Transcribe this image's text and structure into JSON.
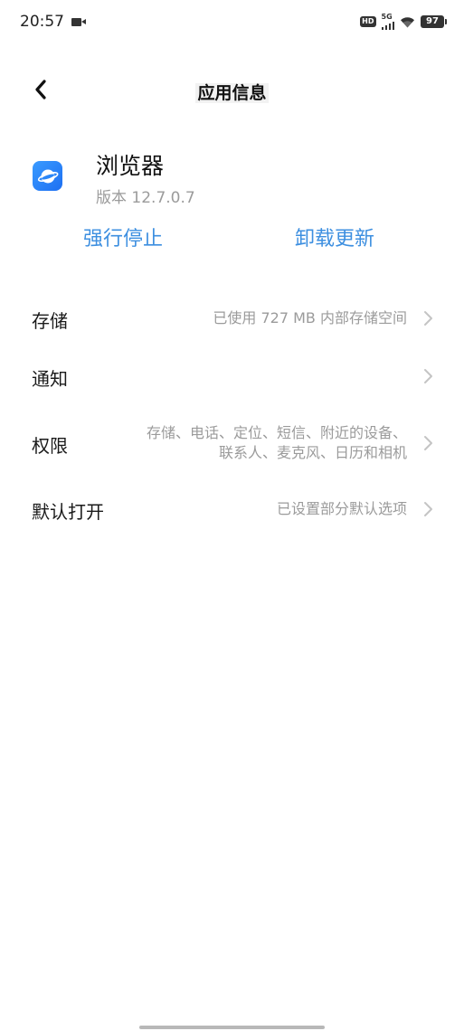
{
  "status_bar": {
    "time": "20:57",
    "hd": "HD",
    "network": "5G",
    "battery": "97"
  },
  "header": {
    "title": "应用信息",
    "back_icon": "chevron-left-icon"
  },
  "app": {
    "name": "浏览器",
    "version": "版本 12.7.0.7",
    "icon": "planet-icon",
    "icon_color": "#2b86f7"
  },
  "actions": {
    "force_stop": "强行停止",
    "uninstall_updates": "卸载更新",
    "color": "#3d8fe0"
  },
  "settings": [
    {
      "label": "存储",
      "value_lines": [
        "已使用 727 MB 内部存储空间"
      ]
    },
    {
      "label": "通知",
      "value_lines": []
    },
    {
      "label": "权限",
      "value_lines": [
        "存储、电话、定位、短信、附近的设备、",
        "联系人、麦克风、日历和相机"
      ]
    },
    {
      "label": "默认打开",
      "value_lines": [
        "已设置部分默认选项"
      ]
    }
  ]
}
